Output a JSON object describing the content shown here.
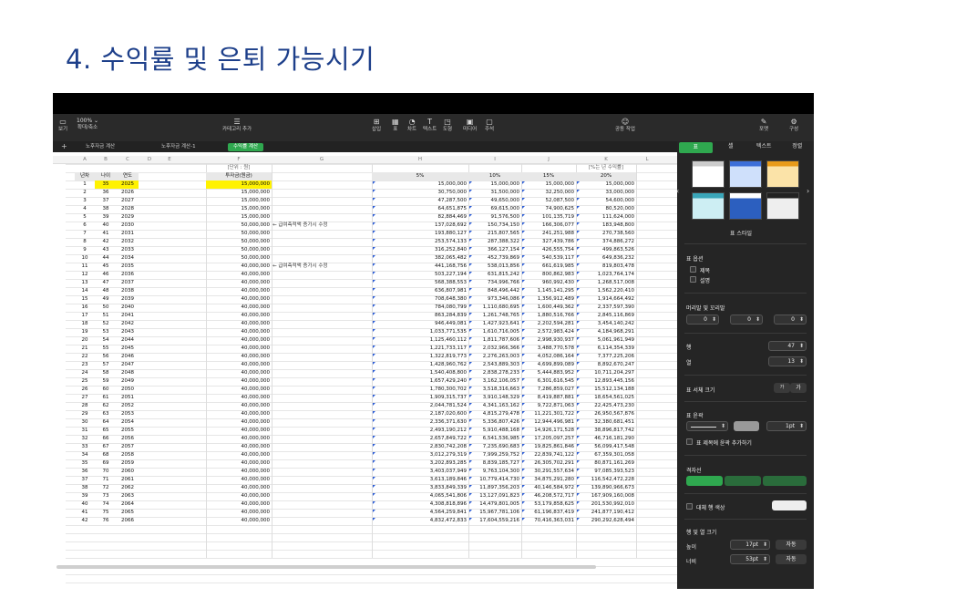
{
  "slide": {
    "title": "4. 수익률 및 은퇴 가능시기"
  },
  "toolbar": {
    "view": "보기",
    "zoom_value": "100% ⌄",
    "zoom": "확대/축소",
    "category": "카테고리 추가",
    "insert": "삽입",
    "table": "표",
    "chart": "차트",
    "text": "텍스트",
    "shape": "도형",
    "media": "미디어",
    "comment": "주석",
    "collaborate": "공동 작업",
    "format": "포맷",
    "organize": "구성"
  },
  "tabs": [
    "노후자금 계산",
    "노후자금 계산-1",
    "수익률 계산"
  ],
  "columns": [
    "A",
    "B",
    "C",
    "D",
    "E",
    "F",
    "G",
    "H",
    "I",
    "J",
    "K",
    "L"
  ],
  "sheet": {
    "unit_left": "[단위 : 원]",
    "unit_right": "[%는 년 수익률]",
    "h_year": "년차",
    "h_age": "나이",
    "h_yr": "연도",
    "h_invest": "투자금(원금)",
    "h_5": "5%",
    "h_10": "10%",
    "h_15": "15%",
    "h_20": "20%",
    "note1": "← 급여측적액 증가시 수정",
    "note2": "← 급여측적액 증가시 수정"
  },
  "rows": [
    [
      "1",
      "35",
      "2025",
      "15,000,000",
      "15,000,000",
      "15,000,000",
      "15,000,000",
      "15,000,000"
    ],
    [
      "2",
      "36",
      "2026",
      "15,000,000",
      "30,750,000",
      "31,500,000",
      "32,250,000",
      "33,000,000"
    ],
    [
      "3",
      "37",
      "2027",
      "15,000,000",
      "47,287,500",
      "49,650,000",
      "52,087,500",
      "54,600,000"
    ],
    [
      "4",
      "38",
      "2028",
      "15,000,000",
      "64,651,875",
      "69,615,000",
      "74,900,625",
      "80,520,000"
    ],
    [
      "5",
      "39",
      "2029",
      "15,000,000",
      "82,884,469",
      "91,576,500",
      "101,135,719",
      "111,624,000"
    ],
    [
      "6",
      "40",
      "2030",
      "50,000,000",
      "137,028,692",
      "150,734,150",
      "166,306,077",
      "183,948,800"
    ],
    [
      "7",
      "41",
      "2031",
      "50,000,000",
      "193,880,127",
      "215,807,565",
      "241,251,988",
      "270,738,560"
    ],
    [
      "8",
      "42",
      "2032",
      "50,000,000",
      "253,574,133",
      "287,388,322",
      "327,439,786",
      "374,886,272"
    ],
    [
      "9",
      "43",
      "2033",
      "50,000,000",
      "316,252,840",
      "366,127,154",
      "426,555,754",
      "499,863,526"
    ],
    [
      "10",
      "44",
      "2034",
      "50,000,000",
      "382,065,482",
      "452,739,869",
      "540,539,117",
      "649,836,232"
    ],
    [
      "11",
      "45",
      "2035",
      "40,000,000",
      "441,168,756",
      "538,013,856",
      "661,619,985",
      "819,803,478"
    ],
    [
      "12",
      "46",
      "2036",
      "40,000,000",
      "503,227,194",
      "631,815,242",
      "800,862,983",
      "1,023,764,174"
    ],
    [
      "13",
      "47",
      "2037",
      "40,000,000",
      "568,388,553",
      "734,996,766",
      "960,992,430",
      "1,268,517,008"
    ],
    [
      "14",
      "48",
      "2038",
      "40,000,000",
      "636,807,981",
      "848,496,442",
      "1,145,141,295",
      "1,562,220,410"
    ],
    [
      "15",
      "49",
      "2039",
      "40,000,000",
      "708,648,380",
      "973,346,086",
      "1,356,912,489",
      "1,914,664,492"
    ],
    [
      "16",
      "50",
      "2040",
      "40,000,000",
      "784,080,799",
      "1,110,680,695",
      "1,600,449,362",
      "2,337,597,390"
    ],
    [
      "17",
      "51",
      "2041",
      "40,000,000",
      "863,284,839",
      "1,261,748,765",
      "1,880,516,766",
      "2,845,116,869"
    ],
    [
      "18",
      "52",
      "2042",
      "40,000,000",
      "946,449,081",
      "1,427,923,641",
      "2,202,594,281",
      "3,454,140,242"
    ],
    [
      "19",
      "53",
      "2043",
      "40,000,000",
      "1,033,771,535",
      "1,610,716,005",
      "2,572,983,424",
      "4,184,968,291"
    ],
    [
      "20",
      "54",
      "2044",
      "40,000,000",
      "1,125,460,112",
      "1,811,787,606",
      "2,998,930,937",
      "5,061,961,949"
    ],
    [
      "21",
      "55",
      "2045",
      "40,000,000",
      "1,221,733,117",
      "2,032,966,366",
      "3,488,770,578",
      "6,114,354,339"
    ],
    [
      "22",
      "56",
      "2046",
      "40,000,000",
      "1,322,819,773",
      "2,276,263,003",
      "4,052,086,164",
      "7,377,225,206"
    ],
    [
      "23",
      "57",
      "2047",
      "40,000,000",
      "1,428,960,762",
      "2,543,889,303",
      "4,699,899,089",
      "8,892,670,247"
    ],
    [
      "24",
      "58",
      "2048",
      "40,000,000",
      "1,540,408,800",
      "2,838,278,233",
      "5,444,883,952",
      "10,711,204,297"
    ],
    [
      "25",
      "59",
      "2049",
      "40,000,000",
      "1,657,429,240",
      "3,162,106,057",
      "6,301,616,545",
      "12,893,445,156"
    ],
    [
      "26",
      "60",
      "2050",
      "40,000,000",
      "1,780,300,702",
      "3,518,316,663",
      "7,286,859,027",
      "15,512,134,188"
    ],
    [
      "27",
      "61",
      "2051",
      "40,000,000",
      "1,909,315,737",
      "3,910,148,329",
      "8,419,887,881",
      "18,654,561,025"
    ],
    [
      "28",
      "62",
      "2052",
      "40,000,000",
      "2,044,781,524",
      "4,341,163,162",
      "9,722,871,063",
      "22,425,473,230"
    ],
    [
      "29",
      "63",
      "2053",
      "40,000,000",
      "2,187,020,600",
      "4,815,279,478",
      "11,221,301,722",
      "26,950,567,876"
    ],
    [
      "30",
      "64",
      "2054",
      "40,000,000",
      "2,336,371,630",
      "5,336,807,426",
      "12,944,496,981",
      "32,380,681,451"
    ],
    [
      "31",
      "65",
      "2055",
      "40,000,000",
      "2,493,190,212",
      "5,910,488,168",
      "14,926,171,528",
      "38,896,817,742"
    ],
    [
      "32",
      "66",
      "2056",
      "40,000,000",
      "2,657,849,722",
      "6,541,536,985",
      "17,205,097,257",
      "46,716,181,290"
    ],
    [
      "33",
      "67",
      "2057",
      "40,000,000",
      "2,830,742,208",
      "7,235,690,683",
      "19,825,861,846",
      "56,099,417,548"
    ],
    [
      "34",
      "68",
      "2058",
      "40,000,000",
      "3,012,279,319",
      "7,999,259,752",
      "22,839,741,122",
      "67,359,301,058"
    ],
    [
      "35",
      "69",
      "2059",
      "40,000,000",
      "3,202,893,285",
      "8,839,185,727",
      "26,305,702,291",
      "80,871,161,269"
    ],
    [
      "36",
      "70",
      "2060",
      "40,000,000",
      "3,403,037,949",
      "9,763,104,300",
      "30,291,557,634",
      "97,085,393,523"
    ],
    [
      "37",
      "71",
      "2061",
      "40,000,000",
      "3,613,189,846",
      "10,779,414,730",
      "34,875,291,280",
      "116,542,472,228"
    ],
    [
      "38",
      "72",
      "2062",
      "40,000,000",
      "3,833,849,339",
      "11,897,356,203",
      "40,146,584,972",
      "139,890,966,673"
    ],
    [
      "39",
      "73",
      "2063",
      "40,000,000",
      "4,065,541,806",
      "13,127,091,823",
      "46,208,572,717",
      "167,909,160,008"
    ],
    [
      "40",
      "74",
      "2064",
      "40,000,000",
      "4,308,818,896",
      "14,479,801,005",
      "53,179,858,625",
      "201,530,992,010"
    ],
    [
      "41",
      "75",
      "2065",
      "40,000,000",
      "4,564,259,841",
      "15,967,781,106",
      "61,196,837,419",
      "241,877,190,412"
    ],
    [
      "42",
      "76",
      "2066",
      "40,000,000",
      "4,832,472,833",
      "17,604,559,216",
      "70,416,363,031",
      "290,292,628,494"
    ]
  ],
  "panel": {
    "tabs": [
      "표",
      "셀",
      "텍스트",
      "정렬"
    ],
    "style_label": "표 스타일",
    "options": "표 옵션",
    "title_opt": "제목",
    "caption_opt": "설명",
    "headers": "머리말 및 꼬리말",
    "h1": "0",
    "h2": "0",
    "h3": "0",
    "rows_label": "행",
    "rows_val": "47",
    "cols_label": "열",
    "cols_val": "13",
    "font_size": "표 서체 크기",
    "font_small": "가",
    "font_big": "가",
    "outline": "표 윤곽",
    "outline_pt": "1pt",
    "title_outline": "표 제목에 윤곽 추가하기",
    "gridlines": "격자선",
    "alt_color": "대체 행 색상",
    "rowcol": "행 및 열 크기",
    "height_label": "높이",
    "height_val": "17pt",
    "width_label": "너비",
    "width_val": "53pt",
    "auto": "자동",
    "auto2": "자동"
  },
  "colors": {
    "accent": "#2fa84f",
    "title": "#1d3f8a",
    "highlight": "#fff200"
  }
}
